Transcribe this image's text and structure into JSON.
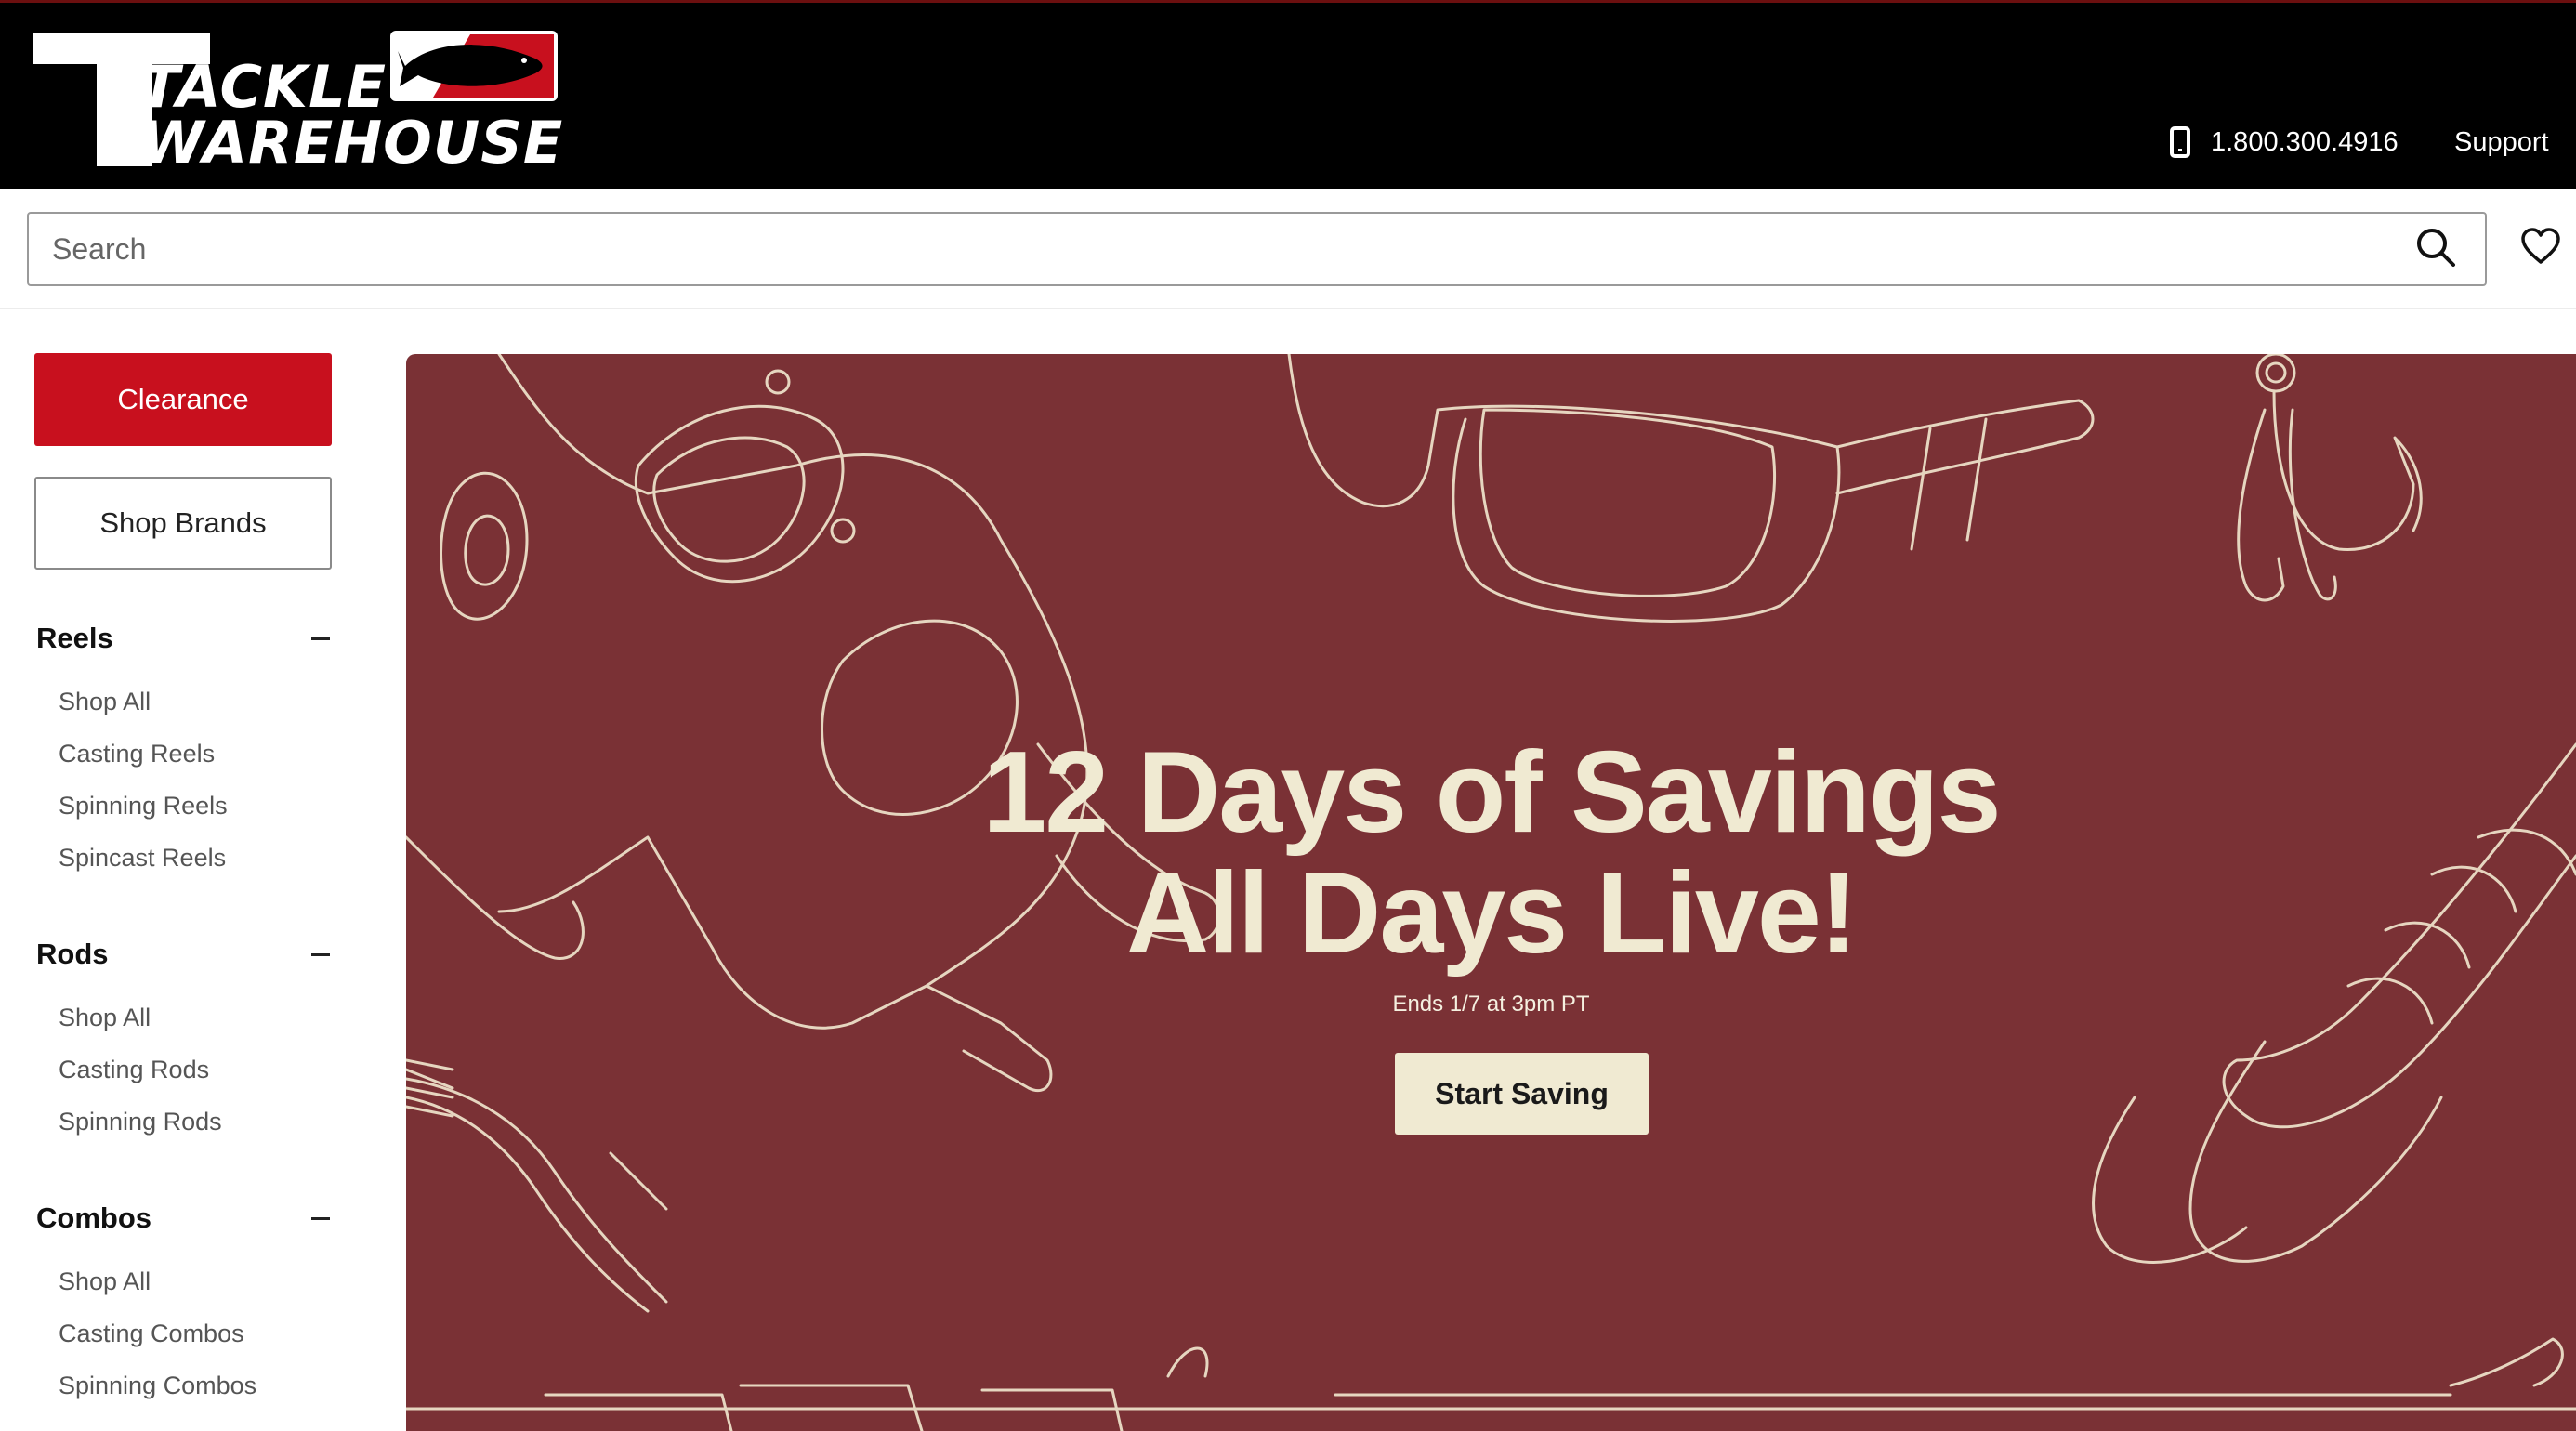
{
  "brand": {
    "line1": "TACKLE",
    "line2": "WAREHOUSE"
  },
  "header": {
    "phone": "1.800.300.4916",
    "support": "Support"
  },
  "search": {
    "placeholder": "Search"
  },
  "sidebar": {
    "clearance": "Clearance",
    "shop_brands": "Shop Brands",
    "categories": [
      {
        "title": "Reels",
        "links": [
          "Shop All",
          "Casting Reels",
          "Spinning Reels",
          "Spincast Reels"
        ]
      },
      {
        "title": "Rods",
        "links": [
          "Shop All",
          "Casting Rods",
          "Spinning Rods"
        ]
      },
      {
        "title": "Combos",
        "links": [
          "Shop All",
          "Casting Combos",
          "Spinning Combos"
        ]
      }
    ]
  },
  "hero": {
    "title_line1": "12 Days of Savings",
    "title_line2": "All Days Live!",
    "subtitle": "Ends 1/7 at 3pm PT",
    "cta": "Start Saving"
  },
  "colors": {
    "header_bg": "#000000",
    "accent_red": "#c8101e",
    "hero_bg": "#7a3135",
    "hero_text": "#f0ead2"
  }
}
